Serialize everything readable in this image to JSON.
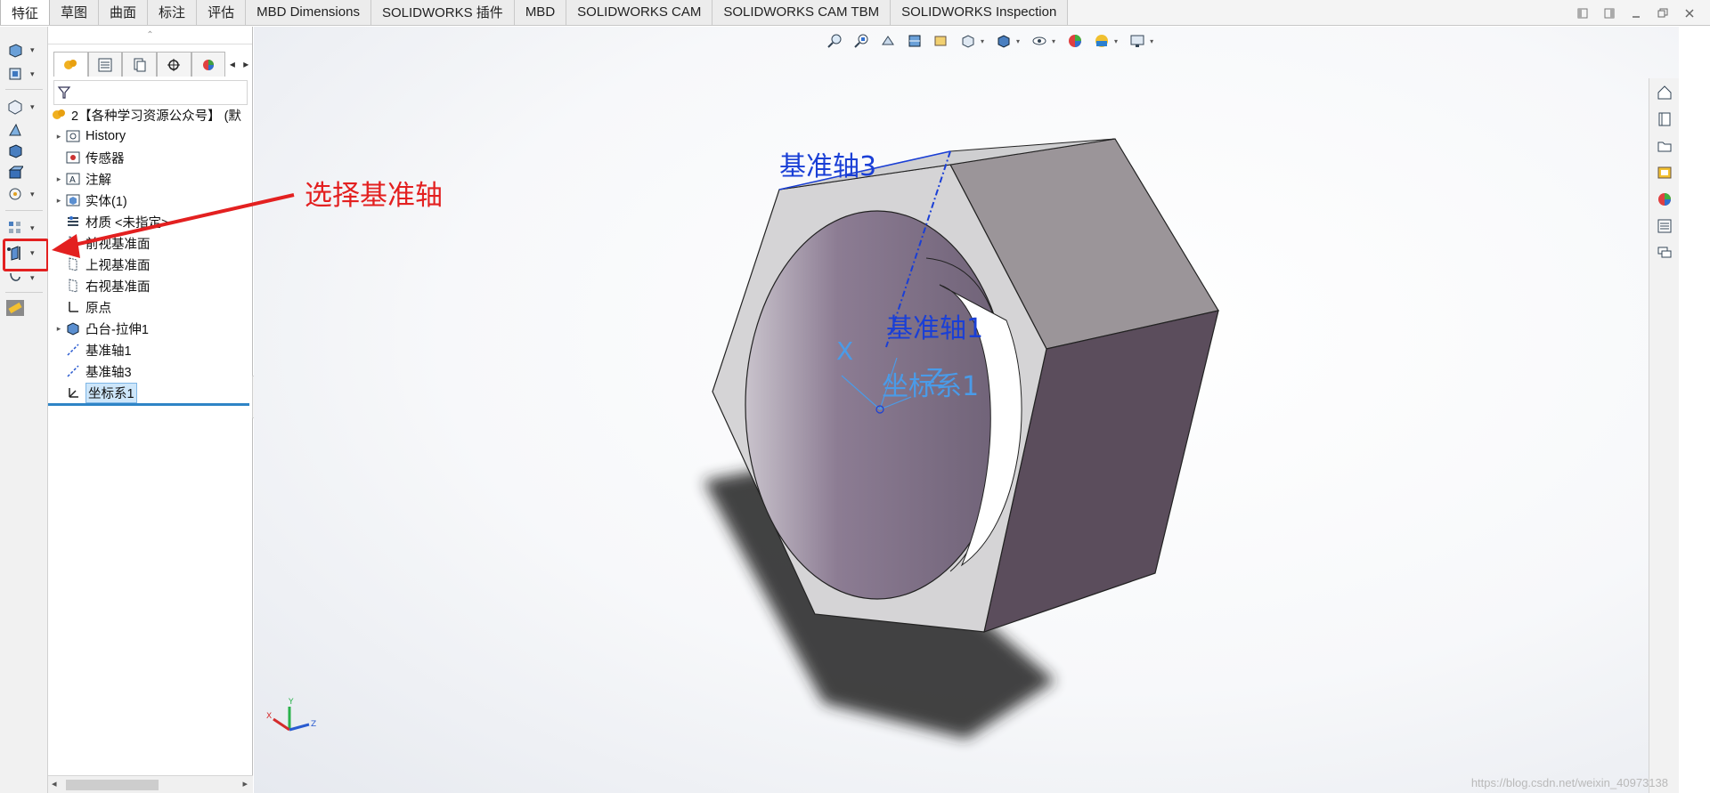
{
  "tabs": [
    "特征",
    "草图",
    "曲面",
    "标注",
    "评估",
    "MBD Dimensions",
    "SOLIDWORKS 插件",
    "MBD",
    "SOLIDWORKS CAM",
    "SOLIDWORKS CAM TBM",
    "SOLIDWORKS Inspection"
  ],
  "active_tab": "特征",
  "feature_tree": {
    "root": "2【各种学习资源公众号】 (默",
    "items": [
      {
        "label": "History",
        "icon": "history-icon"
      },
      {
        "label": "传感器",
        "icon": "sensor-icon"
      },
      {
        "label": "注解",
        "icon": "annotation-icon"
      },
      {
        "label": "实体(1)",
        "icon": "solid-bodies-icon"
      },
      {
        "label": "材质 <未指定>",
        "icon": "material-icon"
      },
      {
        "label": "前视基准面",
        "icon": "plane-icon"
      },
      {
        "label": "上视基准面",
        "icon": "plane-icon"
      },
      {
        "label": "右视基准面",
        "icon": "plane-icon"
      },
      {
        "label": "原点",
        "icon": "origin-icon"
      },
      {
        "label": "凸台-拉伸1",
        "icon": "extrude-icon"
      },
      {
        "label": "基准轴1",
        "icon": "axis-icon"
      },
      {
        "label": "基准轴3",
        "icon": "axis-icon"
      },
      {
        "label": "坐标系1",
        "icon": "coordinate-system-icon"
      }
    ]
  },
  "annotation": {
    "text": "选择基准轴",
    "color": "#e32020"
  },
  "model_labels": {
    "axis3": "基准轴3",
    "axis1": "基准轴1",
    "coord": "坐标系1",
    "x": "X",
    "z": "Z"
  },
  "triad": {
    "x": "X",
    "y": "Y",
    "z": "Z"
  },
  "watermark": "https://blog.csdn.net/weixin_40973138",
  "colors": {
    "accent": "#2e84c6",
    "annotation": "#e32020",
    "axis_blue": "#1a3fd6",
    "coord_blue": "#4a9be8"
  }
}
